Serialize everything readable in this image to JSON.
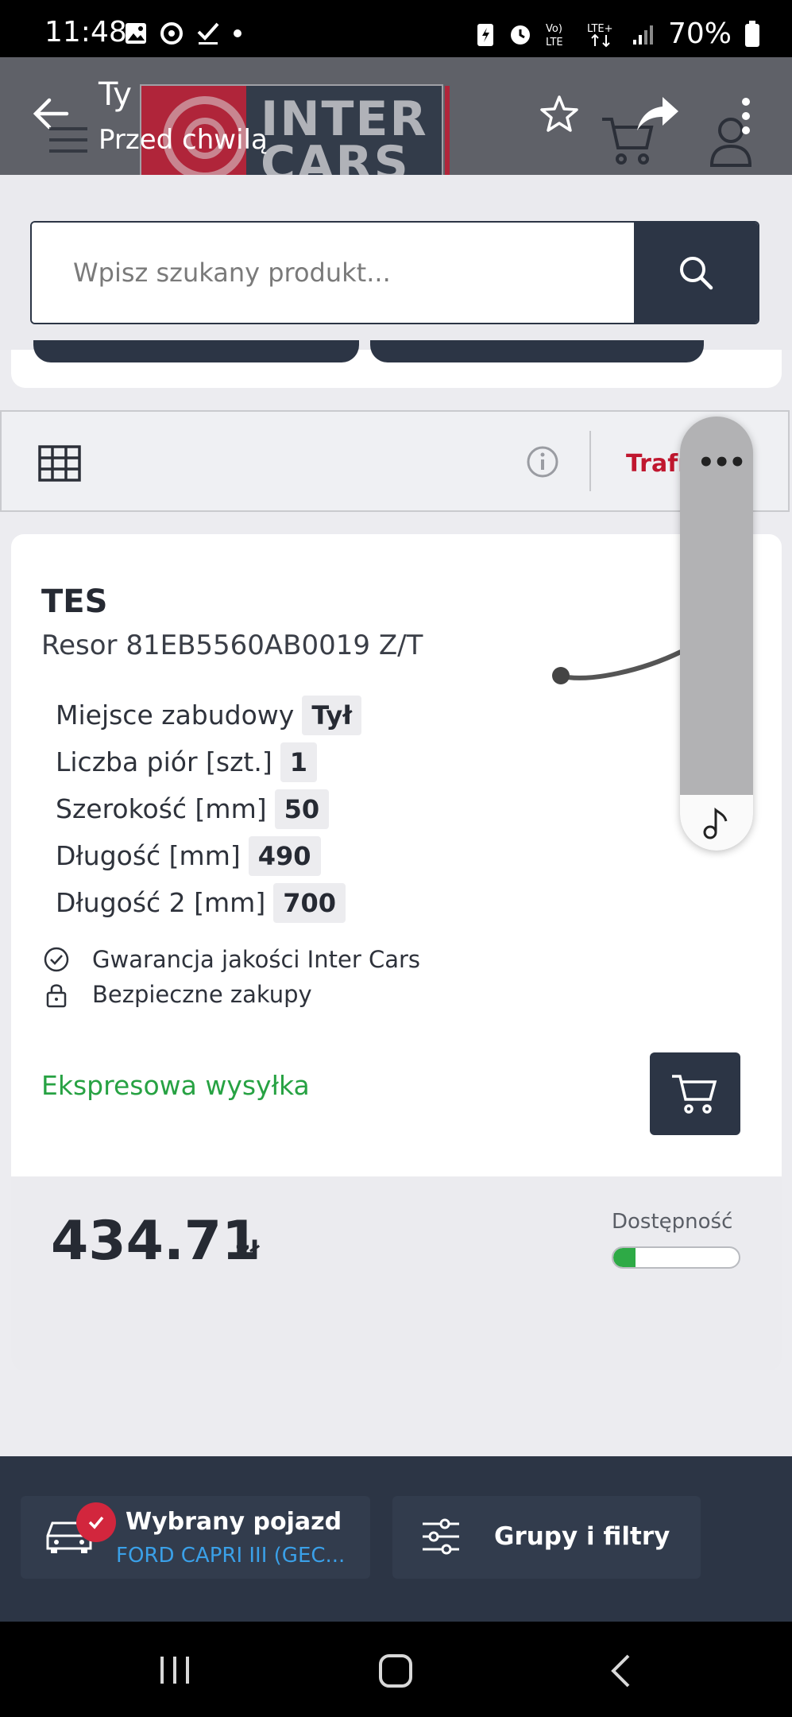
{
  "status_bar": {
    "time": "11:48",
    "battery": "70%"
  },
  "header": {
    "tab_title": "Ty",
    "tab_subtitle": "Przed chwilą",
    "logo_text": "INTER CARS"
  },
  "search": {
    "placeholder": "Wpisz szukany produkt..."
  },
  "view_bar": {
    "sort_label": "Trafność"
  },
  "product": {
    "brand": "TES",
    "name": "Resor 81EB5560AB0019 Z/T",
    "specs": [
      {
        "label": "Miejsce zabudowy",
        "value": "Tył"
      },
      {
        "label": "Liczba piór [szt.]",
        "value": "1"
      },
      {
        "label": "Szerokość [mm]",
        "value": "50"
      },
      {
        "label": "Długość [mm]",
        "value": "490"
      },
      {
        "label": "Długość 2 [mm]",
        "value": "700"
      }
    ],
    "guarantee": "Gwarancja jakości Inter Cars",
    "secure": "Bezpieczne zakupy",
    "delivery": "Ekspresowa wysyłka",
    "price": "434.71",
    "currency": "zł",
    "availability_label": "Dostępność",
    "availability_level": 0.18
  },
  "bottom_bar": {
    "vehicle_title": "Wybrany pojazd",
    "vehicle_name": "FORD CAPRI III (GEC...",
    "filters_label": "Grupy i filtry"
  },
  "colors": {
    "brand_dark": "#2c3545",
    "accent_red": "#c0172f",
    "delivery_green": "#27a243",
    "link_blue": "#3aa0e8"
  }
}
